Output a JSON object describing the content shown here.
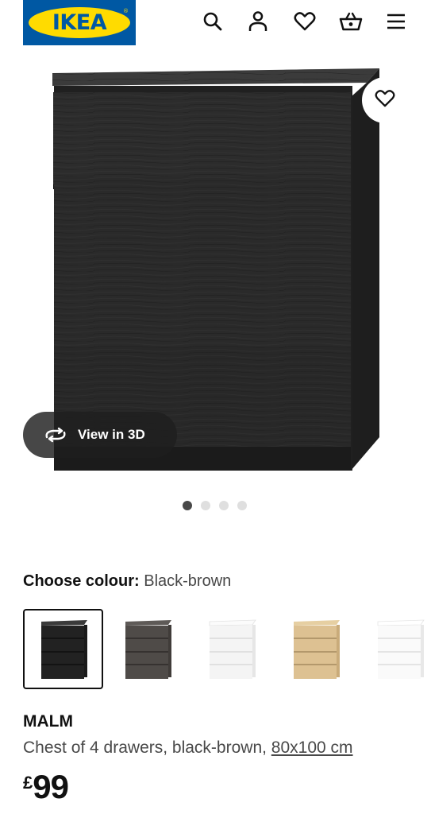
{
  "brand": {
    "logo_text": "IKEA",
    "registered": "®",
    "colors": {
      "blue": "#0058a3",
      "yellow": "#ffdb00"
    }
  },
  "header": {
    "icons": [
      "search-icon",
      "account-icon",
      "wishlist-heart-icon",
      "shopping-basket-icon",
      "menu-icon"
    ]
  },
  "gallery": {
    "product_image": "black-brown chest of 4 drawers",
    "favourite_icon": "heart-outline-icon",
    "view_3d_label": "View in 3D",
    "view_3d_icon": "rotate-3d-icon",
    "slide_count": 4,
    "active_slide": 1
  },
  "colour": {
    "label": "Choose colour:",
    "selected_value": "Black-brown",
    "swatches": [
      {
        "name": "Black-brown",
        "color": "#2b2b2b",
        "selected": true
      },
      {
        "name": "dark grey",
        "color": "#4f4b48",
        "selected": false
      },
      {
        "name": "white",
        "color": "#f4f4f4",
        "selected": false
      },
      {
        "name": "oak veneer",
        "color": "#ddc192",
        "selected": false
      },
      {
        "name": "high-gloss white",
        "color": "#fafafa",
        "selected": false
      }
    ]
  },
  "product": {
    "name": "MALM",
    "description": "Chest of 4 drawers, black-brown, ",
    "size": "80x100 cm",
    "currency": "£",
    "price": "99"
  }
}
